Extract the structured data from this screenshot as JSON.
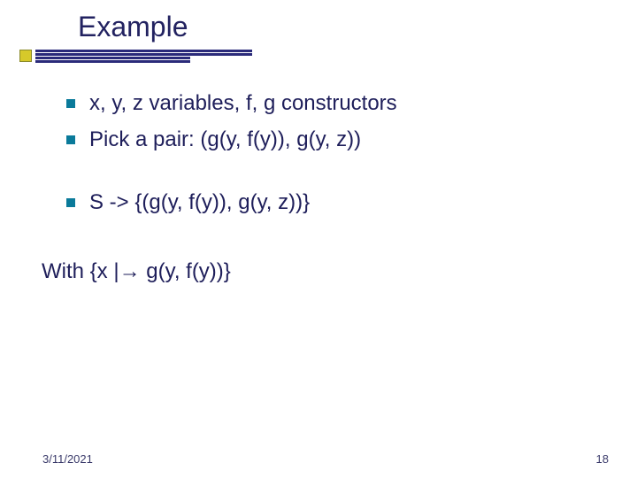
{
  "title": "Example",
  "bullets_group1": [
    "x, y, z variables, f, g constructors",
    "Pick a pair: (g(y, f(y)), g(y, z))"
  ],
  "bullets_group2": [
    "S -> {(g(y, f(y)), g(y, z))}"
  ],
  "plain_text": "With {x |→ g(y, f(y))}",
  "footer": {
    "date": "3/11/2021",
    "page": "18"
  }
}
